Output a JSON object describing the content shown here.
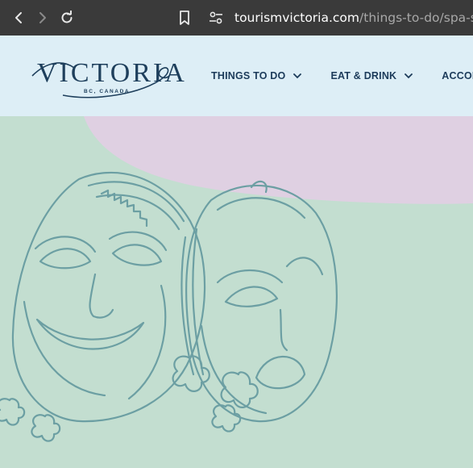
{
  "browser": {
    "url_domain": "tourismvictoria.com",
    "url_path": "/things-to-do/spa-shoppi",
    "icons": [
      "back-icon",
      "forward-icon",
      "reload-icon",
      "bookmark-icon",
      "site-settings-icon"
    ]
  },
  "header": {
    "logo_title": "VICTORIA",
    "logo_subtitle": "BC, CANADA",
    "nav": [
      {
        "label": "THINGS TO DO"
      },
      {
        "label": "EAT & DRINK"
      },
      {
        "label": "ACCOMM"
      }
    ]
  },
  "colors": {
    "header_bg": "#ddeef6",
    "navy": "#1c3b5a",
    "hero_green": "#c3ded0",
    "hero_pink": "#dfd0e2",
    "illustration": "#6c9fa3"
  }
}
